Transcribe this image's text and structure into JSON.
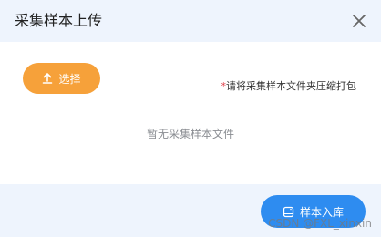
{
  "dialog": {
    "title": "采集样本上传",
    "close_icon": "close-icon",
    "select_button": {
      "icon": "upload-icon",
      "label": "选择"
    },
    "hint": {
      "required_mark": "*",
      "text": "请将采集样本文件夹压缩打包"
    },
    "empty_text": "暂无采集样本文件",
    "submit_button": {
      "icon": "database-icon",
      "label": "样本入库"
    }
  },
  "watermark": "CSDN @FXL_xinxin",
  "colors": {
    "header_bg": "#eef4fd",
    "select_button": "#f6a13a",
    "submit_button": "#2e8cf0",
    "required_mark": "#e0414b"
  }
}
